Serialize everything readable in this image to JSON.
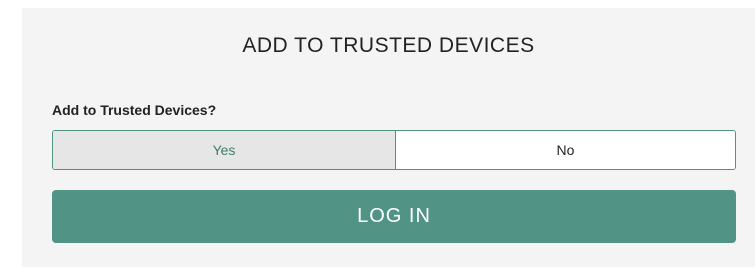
{
  "panel": {
    "title": "ADD TO TRUSTED DEVICES",
    "question": "Add to Trusted Devices?",
    "options": [
      {
        "label": "Yes",
        "selected": true
      },
      {
        "label": "No",
        "selected": false
      }
    ],
    "login_label": "LOG IN"
  },
  "colors": {
    "accent": "#519485",
    "panel_bg": "#f4f4f4",
    "selected_bg": "#e6e6e6"
  }
}
